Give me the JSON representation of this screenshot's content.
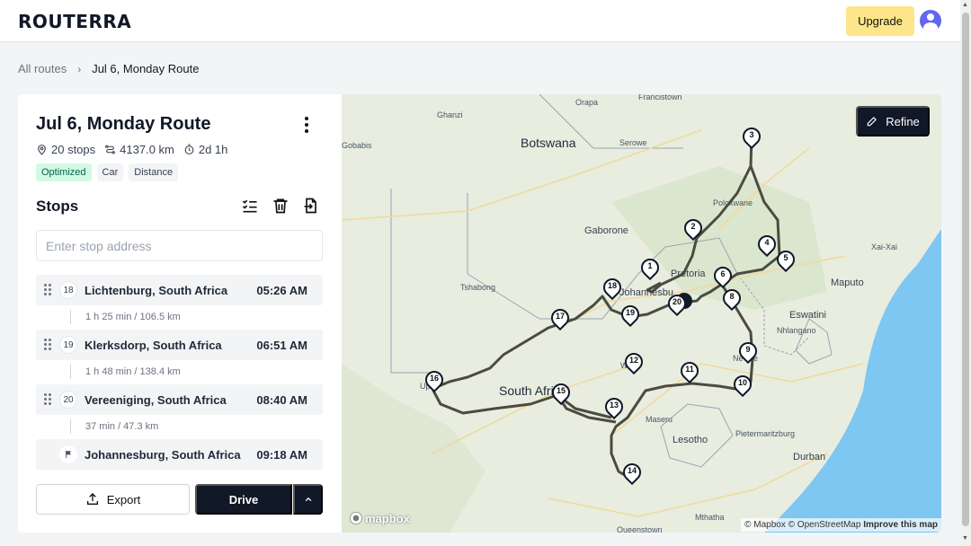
{
  "app": {
    "logo": "ROUTERRA",
    "upgrade_label": "Upgrade",
    "avatar_icon": "user-icon"
  },
  "breadcrumb": {
    "parent": "All routes",
    "current": "Jul 6, Monday Route"
  },
  "route": {
    "title": "Jul 6, Monday Route",
    "stops_count": "20 stops",
    "distance": "4137.0 km",
    "duration": "2d 1h",
    "badges": [
      "Optimized",
      "Car",
      "Distance"
    ]
  },
  "stops_section": {
    "title": "Stops",
    "input_placeholder": "Enter stop address",
    "stops": [
      {
        "number": "18",
        "name": "Lichtenburg, South Africa",
        "time": "05:26 AM"
      },
      {
        "number": "19",
        "name": "Klerksdorp, South Africa",
        "time": "06:51 AM"
      },
      {
        "number": "20",
        "name": "Vereeniging, South Africa",
        "time": "08:40 AM"
      },
      {
        "number": "",
        "name": "Johannesburg, South Africa",
        "time": "09:18 AM"
      }
    ],
    "legs": [
      "1 h 25 min / 106.5 km",
      "1 h 48 min / 138.4 km",
      "37 min / 47.3 km"
    ]
  },
  "actions": {
    "export_label": "Export",
    "drive_label": "Drive"
  },
  "map": {
    "refine_label": "Refine",
    "mapbox_label": "mapbox",
    "attribution_mapbox": "© Mapbox",
    "attribution_osm": "© OpenStreetMap",
    "attribution_improve": "Improve this map",
    "place_labels": {
      "botswana": "Botswana",
      "south_africa": "South Afri",
      "eswatini": "Eswatini",
      "lesotho": "Lesotho",
      "maputo": "Maputo",
      "pretoria": "Pretoria",
      "johannesburg": "Johannesbu",
      "gaborone": "Gaborone",
      "polokwane": "Polokwane",
      "maseru": "Maseru",
      "durban": "Durban",
      "pietermaritzburg": "Pietermaritzburg",
      "ghanzi": "Ghanzi",
      "gobabis": "Gobabis",
      "francistown": "Francistown",
      "orapa": "Orapa",
      "serowe": "Serowe",
      "tshabong": "Tshabong",
      "nhlangano": "Nhlangano",
      "newcastle": "Ne    stle",
      "welkom": "W    m",
      "upington": "Up",
      "mthatha": "Mthatha",
      "queenstown": "Queenstown",
      "xai_xai": "Xai-Xai"
    },
    "markers": [
      "1",
      "2",
      "3",
      "4",
      "5",
      "6",
      "8",
      "9",
      "10",
      "11",
      "12",
      "13",
      "14",
      "15",
      "16",
      "17",
      "18",
      "19",
      "20"
    ]
  },
  "colors": {
    "primary": "#111827",
    "upgrade_bg": "#fde68a",
    "optimized_badge_bg": "#d1fae5",
    "map_land": "#e8ede0",
    "map_ocean": "#7dc7f2",
    "route_line": "#4b4b3f"
  }
}
